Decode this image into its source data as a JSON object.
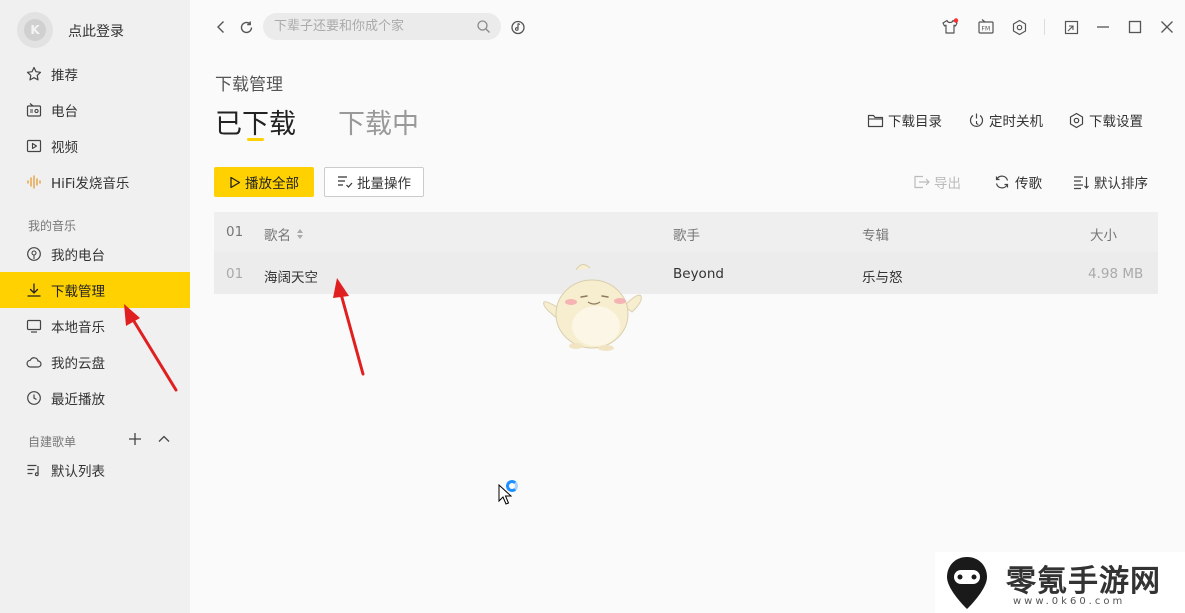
{
  "sidebar": {
    "login_label": "点此登录",
    "avatar_glyph": "K",
    "items": [
      {
        "label": "推荐",
        "icon": "star-icon"
      },
      {
        "label": "电台",
        "icon": "radio-icon"
      },
      {
        "label": "视频",
        "icon": "video-icon"
      },
      {
        "label": "HiFi发烧音乐",
        "icon": "soundwave-icon"
      }
    ],
    "my_music_label": "我的音乐",
    "my_items": [
      {
        "label": "我的电台",
        "icon": "podcast-icon"
      },
      {
        "label": "下载管理",
        "icon": "download-icon",
        "active": true
      },
      {
        "label": "本地音乐",
        "icon": "monitor-icon"
      },
      {
        "label": "我的云盘",
        "icon": "cloud-icon"
      },
      {
        "label": "最近播放",
        "icon": "clock-icon"
      }
    ],
    "playlist_section_label": "自建歌单",
    "playlists": [
      {
        "label": "默认列表",
        "icon": "playlist-icon"
      }
    ]
  },
  "topbar": {
    "search_placeholder": "下辈子还要和你成个家"
  },
  "page": {
    "subtitle": "下载管理",
    "tabs": [
      {
        "label": "已下载",
        "active": true
      },
      {
        "label": "下载中",
        "active": false
      }
    ],
    "actions": {
      "download_dir": "下载目录",
      "timer_shutdown": "定时关机",
      "download_settings": "下载设置"
    },
    "toolbar": {
      "play_all": "播放全部",
      "batch": "批量操作",
      "export": "导出",
      "transfer": "传歌",
      "sort": "默认排序"
    }
  },
  "table": {
    "header": {
      "index": "01",
      "name": "歌名",
      "artist": "歌手",
      "album": "专辑",
      "size": "大小"
    },
    "rows": [
      {
        "index": "01",
        "name": "海阔天空",
        "artist": "Beyond",
        "album": "乐与怒",
        "size": "4.98 MB"
      }
    ]
  },
  "watermark": {
    "text": "零氪手游网",
    "url": "www.0k60.com"
  },
  "colors": {
    "accent": "#ffd100",
    "arrow": "#e02020",
    "sidebar_bg": "#f0f0f0"
  }
}
